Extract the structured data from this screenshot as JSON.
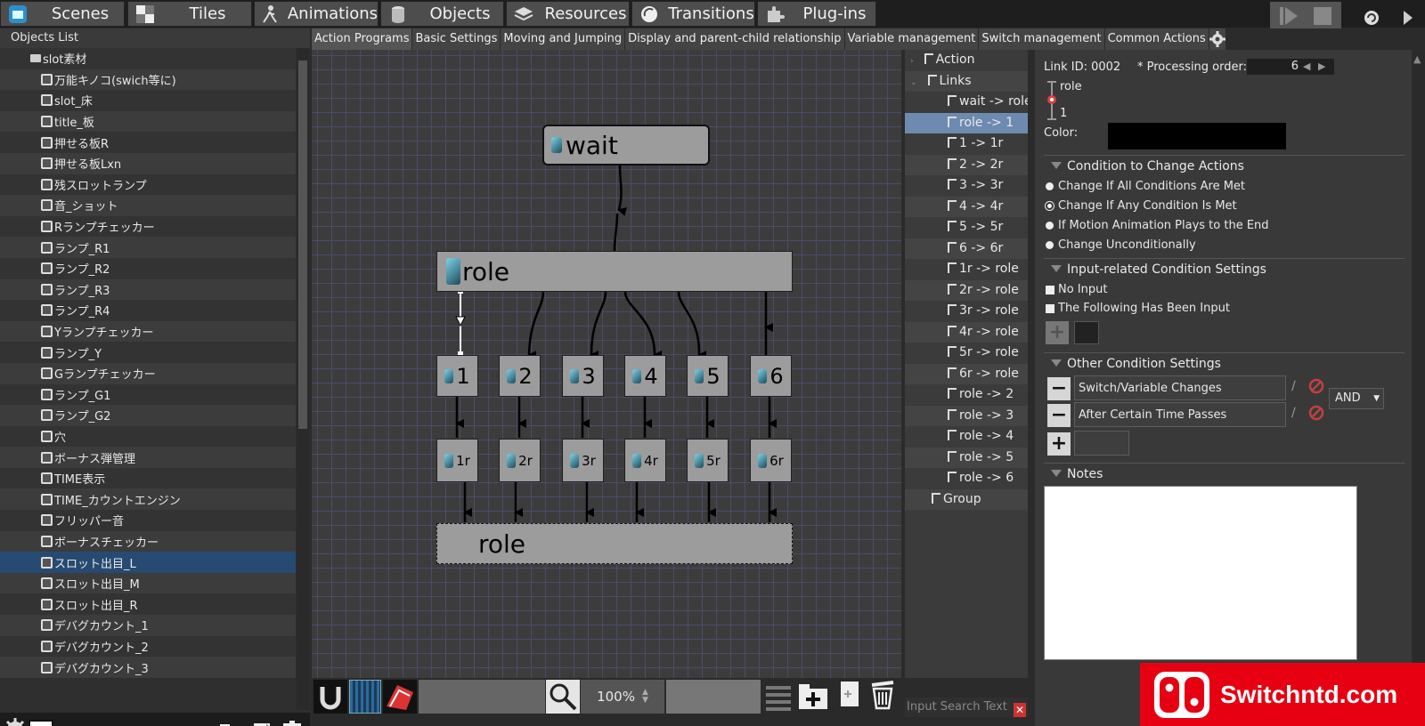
{
  "top_tabs": [
    {
      "label": "Scenes",
      "icon": "scenes-icon"
    },
    {
      "label": "Tiles",
      "icon": "tiles-icon"
    },
    {
      "label": "Animations",
      "icon": "animations-icon"
    },
    {
      "label": "Objects",
      "icon": "objects-icon"
    },
    {
      "label": "Resources",
      "icon": "resources-icon"
    },
    {
      "label": "Transitions",
      "icon": "transitions-icon"
    },
    {
      "label": "Plug-ins",
      "icon": "plugins-icon"
    }
  ],
  "objects_panel": {
    "title": "Objects List",
    "folder": "slot素材",
    "items": [
      "万能キノコ(swich等に)",
      "slot_床",
      "title_板",
      "押せる板R",
      "押せる板Lxn",
      "残スロットランプ",
      "音_ショット",
      "Rランプチェッカー",
      "ランプ_R1",
      "ランプ_R2",
      "ランプ_R3",
      "ランプ_R4",
      "Yランプチェッカー",
      "ランプ_Y",
      "Gランプチェッカー",
      "ランプ_G1",
      "ランプ_G2",
      "穴",
      "ボーナス弾管理",
      "TIME表示",
      "TIME_カウントエンジン",
      "フリッパー音",
      "ボーナスチェッカー",
      "スロット出目_L",
      "スロット出目_M",
      "スロット出目_R",
      "デバグカウント_1",
      "デバグカウント_2",
      "デバグカウント_3"
    ],
    "selected_index": 23
  },
  "sub_tabs": [
    "Action Programs",
    "Basic Settings",
    "Moving and Jumping",
    "Display and parent-child relationship",
    "Variable management",
    "Switch management",
    "Common Actions"
  ],
  "graph": {
    "wait_node": "wait",
    "role_node": "role",
    "numbered_nodes": [
      "1",
      "2",
      "3",
      "4",
      "5",
      "6"
    ],
    "r_nodes": [
      "1r",
      "2r",
      "3r",
      "4r",
      "5r",
      "6r"
    ],
    "bottom_node": "role"
  },
  "canvas_toolbar": {
    "zoom": "100%"
  },
  "tree": {
    "action_label": "Action",
    "links_label": "Links",
    "links": [
      "wait -> role",
      "role -> 1",
      "1 -> 1r",
      "2 -> 2r",
      "3 -> 3r",
      "4 -> 4r",
      "5 -> 5r",
      "6 -> 6r",
      "1r -> role",
      "2r -> role",
      "3r -> role",
      "4r -> role",
      "5r -> role",
      "6r -> role",
      "role -> 2",
      "role -> 3",
      "role -> 4",
      "role -> 5",
      "role -> 6"
    ],
    "selected_link": 1,
    "group_label": "Group",
    "search_placeholder": "Input Search Text"
  },
  "props": {
    "link_id": "Link ID: 0002",
    "processing_order_label": "* Processing order:",
    "processing_order_value": "6",
    "from": "role",
    "to": "1",
    "color_label": "Color:",
    "condition_section": "Condition to Change Actions",
    "radios": [
      "Change If All Conditions Are Met",
      "Change If Any Condition Is Met",
      "If Motion Animation Plays to the End",
      "Change Unconditionally"
    ],
    "radio_selected": 1,
    "input_section": "Input-related Condition Settings",
    "checks": [
      "No Input",
      "The Following Has Been Input"
    ],
    "other_section": "Other Condition Settings",
    "conditions": [
      "Switch/Variable Changes",
      "After Certain Time Passes"
    ],
    "and_label": "AND",
    "notes_section": "Notes"
  },
  "watermark": "Switchntd.com",
  "colors": {
    "selected_row": "#264a72",
    "tree_selected": "#6e8ab0",
    "watermark_red": "#e60012"
  }
}
